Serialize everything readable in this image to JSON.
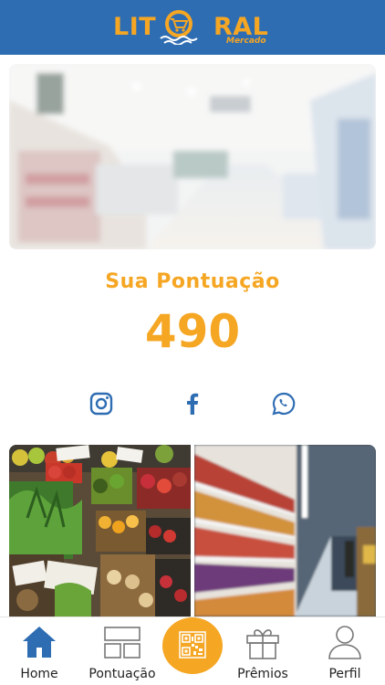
{
  "header": {
    "brand_left": "LIT",
    "brand_right": "RAL",
    "brand_sub": "Mercado",
    "colors": {
      "bar": "#2f6db3",
      "brand": "#f5a623"
    }
  },
  "hero": {
    "image": "supermarket-aisle-blurred-photo"
  },
  "score": {
    "title": "Sua Pontuação",
    "value": "490"
  },
  "social": {
    "items": [
      {
        "icon": "instagram-icon"
      },
      {
        "icon": "facebook-icon"
      },
      {
        "icon": "whatsapp-icon"
      }
    ]
  },
  "tiles": [
    {
      "image": "produce-market-photo"
    },
    {
      "image": "store-shelves-photo"
    }
  ],
  "nav": {
    "items": [
      {
        "label": "Home",
        "icon": "home-icon",
        "active": true
      },
      {
        "label": "Pontuação",
        "icon": "layout-icon"
      },
      {
        "label": "",
        "icon": "qr-code-icon"
      },
      {
        "label": "Prêmios",
        "icon": "gift-icon"
      },
      {
        "label": "Perfil",
        "icon": "user-icon"
      }
    ]
  }
}
